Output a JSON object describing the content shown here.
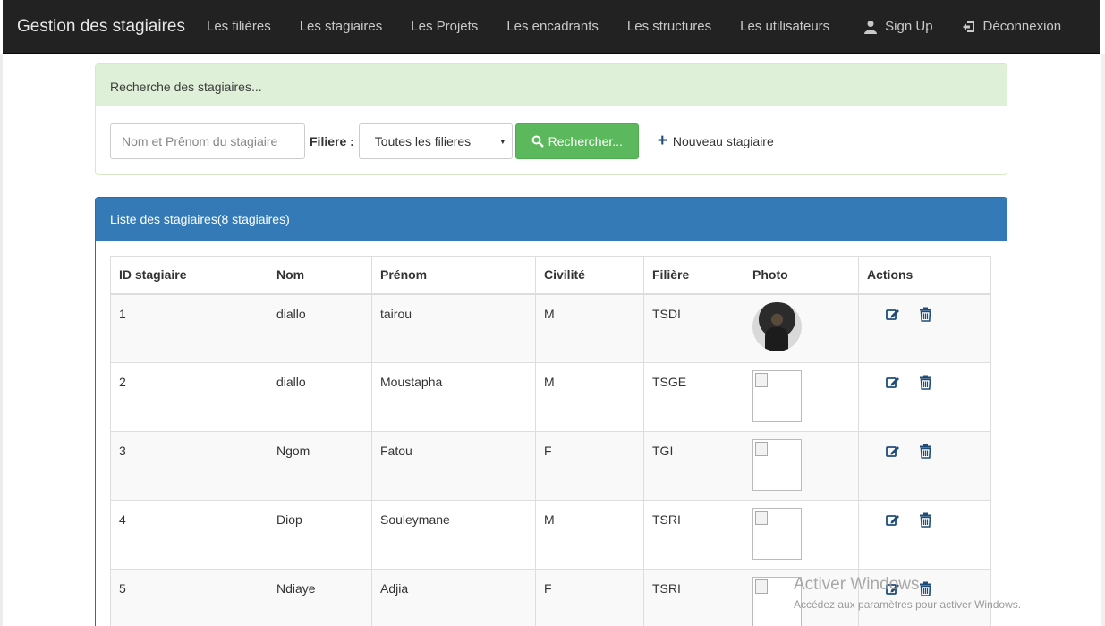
{
  "navbar": {
    "brand": "Gestion des stagiaires",
    "links": [
      "Les filières",
      "Les stagiaires",
      "Les Projets",
      "Les encadrants",
      "Les structures",
      "Les utilisateurs"
    ],
    "signup": "Sign Up",
    "logout": "Déconnexion"
  },
  "search_panel": {
    "heading": "Recherche des stagiaires...",
    "name_placeholder": "Nom et Prênom du stagiaire",
    "filiere_label": "Filiere :",
    "filiere_selected": "Toutes les filieres",
    "search_button": "Rechercher...",
    "new_link": "Nouveau stagiaire"
  },
  "list_panel": {
    "heading": "Liste des stagiaires(8 stagiaires)",
    "columns": [
      "ID stagiaire",
      "Nom",
      "Prénom",
      "Civilité",
      "Filière",
      "Photo",
      "Actions"
    ],
    "rows": [
      {
        "id": "1",
        "nom": "diallo",
        "prenom": "tairou",
        "civilite": "M",
        "filiere": "TSDI",
        "photo": "portrait"
      },
      {
        "id": "2",
        "nom": "diallo",
        "prenom": "Moustapha",
        "civilite": "M",
        "filiere": "TSGE",
        "photo": "broken"
      },
      {
        "id": "3",
        "nom": "Ngom",
        "prenom": "Fatou",
        "civilite": "F",
        "filiere": "TGI",
        "photo": "broken"
      },
      {
        "id": "4",
        "nom": "Diop",
        "prenom": "Souleymane",
        "civilite": "M",
        "filiere": "TSRI",
        "photo": "broken"
      },
      {
        "id": "5",
        "nom": "Ndiaye",
        "prenom": "Adjia",
        "civilite": "F",
        "filiere": "TSRI",
        "photo": "broken"
      }
    ]
  },
  "watermark": {
    "title": "Activer Windows",
    "subtitle": "Accédez aux paramètres pour activer Windows."
  },
  "colors": {
    "navbar_bg": "#222222",
    "success_bg": "#dff0d8",
    "success_button": "#5cb85c",
    "primary": "#337ab7",
    "icon_blue": "#1f4d7a"
  }
}
